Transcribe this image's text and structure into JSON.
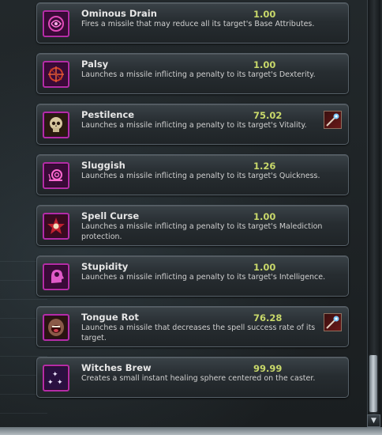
{
  "spells": [
    {
      "name": "Ominous Drain",
      "value": "1.00",
      "description": "Fires a missile that may reduce all its target's Base Attributes.",
      "icon": "swirl-icon",
      "has_item": false
    },
    {
      "name": "Palsy",
      "value": "1.00",
      "description": "Launches a missile inflicting a penalty to its target's Dexterity.",
      "icon": "crosshair-icon",
      "has_item": false
    },
    {
      "name": "Pestilence",
      "value": "75.02",
      "description": "Launches a missile inflicting a penalty to its target's Vitality.",
      "icon": "skull-icon",
      "has_item": true,
      "item_icon": "wand-icon"
    },
    {
      "name": "Sluggish",
      "value": "1.26",
      "description": "Launches a missile inflicting a penalty to its target's Quickness.",
      "icon": "snail-icon",
      "has_item": false
    },
    {
      "name": "Spell Curse",
      "value": "1.00",
      "description": "Launches a missile inflicting a penalty to its target's Malediction protection.",
      "icon": "star-skull-icon",
      "has_item": false
    },
    {
      "name": "Stupidity",
      "value": "1.00",
      "description": "Launches a missile inflicting a penalty to its target's Intelligence.",
      "icon": "head-icon",
      "has_item": false
    },
    {
      "name": "Tongue Rot",
      "value": "76.28",
      "description": "Launches a missile that decreases the spell success rate of its target.",
      "icon": "mouth-icon",
      "has_item": true,
      "item_icon": "wand-icon"
    },
    {
      "name": "Witches Brew",
      "value": "99.99",
      "description": "Creates a small instant healing sphere centered on the caster.",
      "icon": "sparkles-icon",
      "has_item": false
    }
  ],
  "colors": {
    "icon_border": "#b42ca6",
    "value": "#c8d86a",
    "name": "#e6e6e6"
  }
}
